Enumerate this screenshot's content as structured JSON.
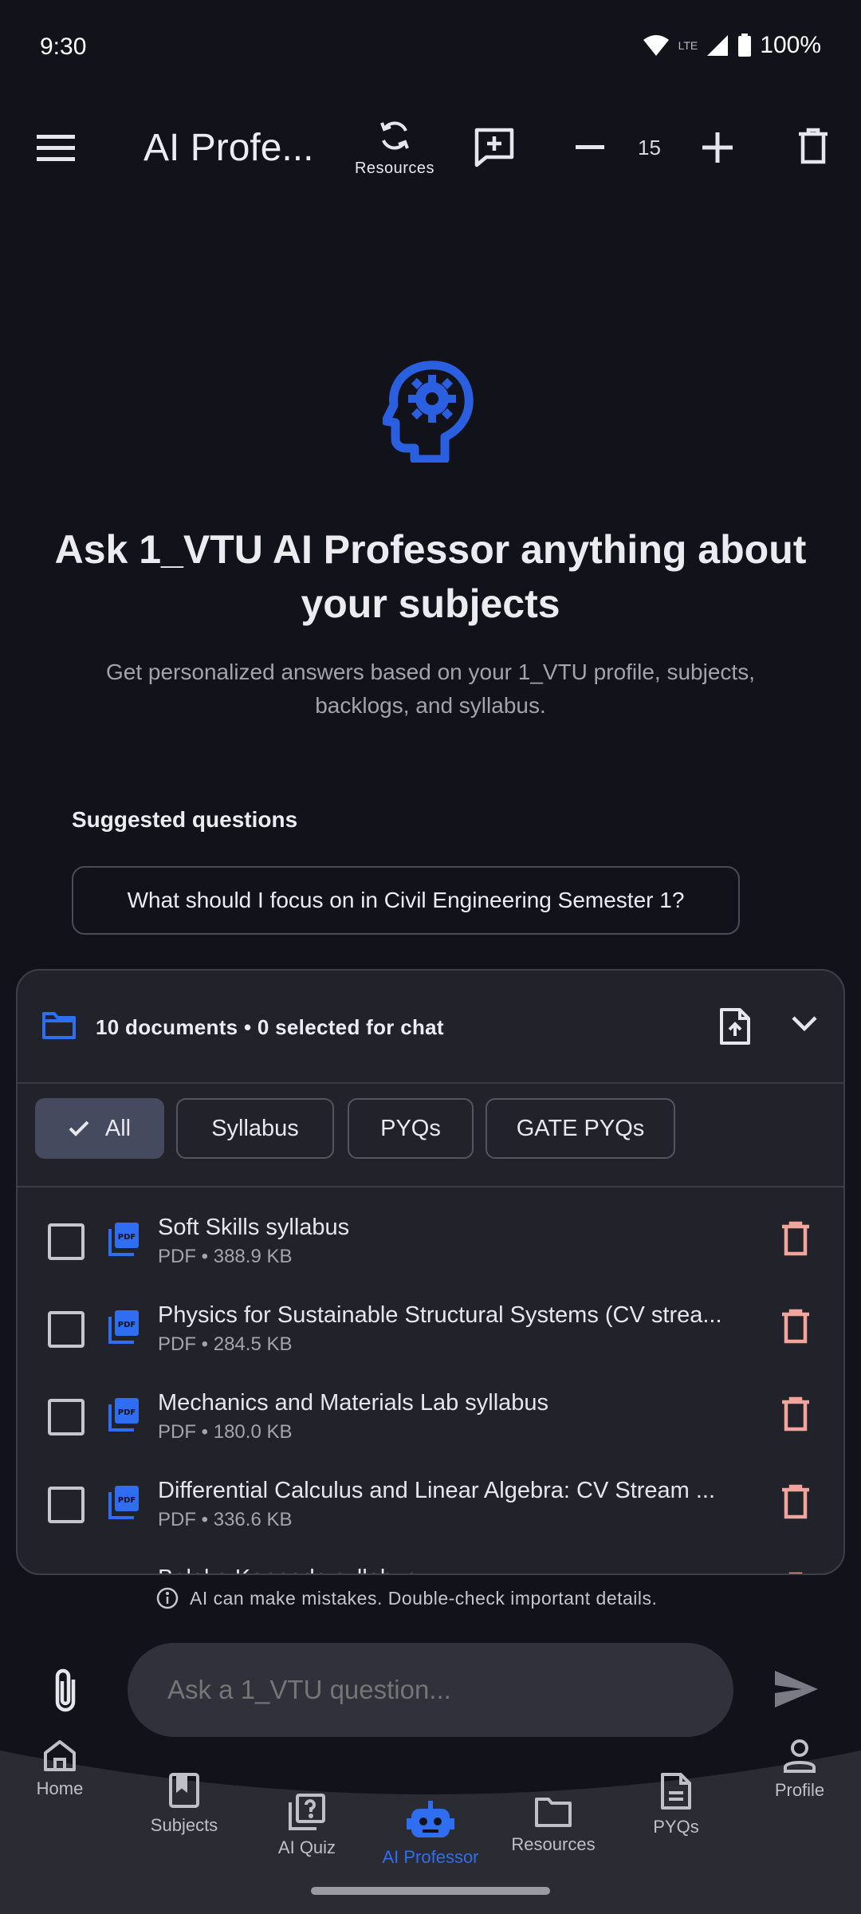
{
  "status_bar": {
    "time": "9:30",
    "network": "LTE",
    "battery": "100%"
  },
  "app_bar": {
    "title": "AI Profe...",
    "resources_label": "Resources",
    "count_value": "15"
  },
  "hero": {
    "title": "Ask 1_VTU AI Professor anything about your subjects",
    "subtitle": "Get personalized answers based on your 1_VTU profile, subjects, backlogs, and syllabus."
  },
  "suggestions": {
    "label": "Suggested questions",
    "items": [
      "What should I focus on in Civil Engineering Semester 1?"
    ]
  },
  "documents": {
    "summary": "10 documents • 0 selected for chat",
    "filters": [
      "All",
      "Syllabus",
      "PYQs",
      "GATE PYQs"
    ],
    "selected_filter": "All",
    "items": [
      {
        "name": "Soft Skills syllabus",
        "meta": "PDF • 388.9 KB"
      },
      {
        "name": "Physics for Sustainable Structural Systems (CV strea...",
        "meta": "PDF • 284.5 KB"
      },
      {
        "name": "Mechanics and Materials Lab syllabus",
        "meta": "PDF • 180.0 KB"
      },
      {
        "name": "Differential Calculus and Linear Algebra: CV Stream ...",
        "meta": "PDF • 336.6 KB"
      },
      {
        "name": "Balake Kannada syllabus",
        "meta": ""
      }
    ]
  },
  "disclaimer": "AI can make mistakes. Double-check important details.",
  "composer": {
    "placeholder": "Ask a 1_VTU question..."
  },
  "bottom_nav": {
    "items": [
      {
        "label": "Home",
        "icon": "home-icon"
      },
      {
        "label": "Subjects",
        "icon": "bookmark-book-icon"
      },
      {
        "label": "AI Quiz",
        "icon": "quiz-icon"
      },
      {
        "label": "AI Professor",
        "icon": "robot-icon"
      },
      {
        "label": "Resources",
        "icon": "folder-icon"
      },
      {
        "label": "PYQs",
        "icon": "document-icon"
      },
      {
        "label": "Profile",
        "icon": "person-icon"
      }
    ],
    "active": "AI Professor"
  },
  "colors": {
    "background": "#12131a",
    "panel": "#22222a",
    "accent": "#2f6ef0",
    "delete": "#f2a59c",
    "selected_chip": "#464a5e"
  }
}
